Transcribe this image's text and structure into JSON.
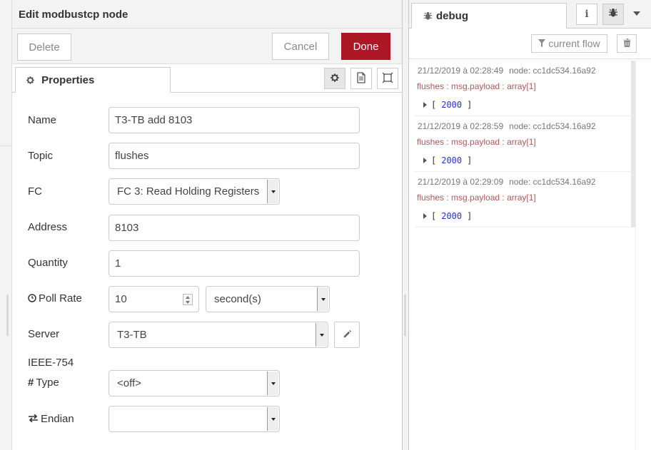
{
  "editor": {
    "title": "Edit modbustcp node",
    "delete_label": "Delete",
    "cancel_label": "Cancel",
    "done_label": "Done",
    "properties_tab": "Properties",
    "fields": {
      "name_label": "Name",
      "name_value": "T3-TB add 8103",
      "topic_label": "Topic",
      "topic_value": "flushes",
      "fc_label": "FC",
      "fc_value": "FC 3: Read Holding Registers",
      "address_label": "Address",
      "address_value": "8103",
      "quantity_label": "Quantity",
      "quantity_value": "1",
      "pollrate_label": "Poll Rate",
      "pollrate_value": "10",
      "pollrate_unit": "second(s)",
      "server_label": "Server",
      "server_value": "T3-TB",
      "ieee_label": "IEEE-754",
      "type_label": "Type",
      "type_value": "<off>",
      "endian_label": "Endian",
      "endian_value": ""
    }
  },
  "sidebar": {
    "tab_label": "debug",
    "info_icon": "i",
    "filter_label": "current flow",
    "messages": [
      {
        "timestamp": "21/12/2019 à 02:28:49",
        "node": "node: cc1dc534.16a92",
        "path": "flushes : msg.payload : array[1]",
        "open": "[",
        "value": "2000",
        "close": "]"
      },
      {
        "timestamp": "21/12/2019 à 02:28:59",
        "node": "node: cc1dc534.16a92",
        "path": "flushes : msg.payload : array[1]",
        "open": "[",
        "value": "2000",
        "close": "]"
      },
      {
        "timestamp": "21/12/2019 à 02:29:09",
        "node": "node: cc1dc534.16a92",
        "path": "flushes : msg.payload : array[1]",
        "open": "[",
        "value": "2000",
        "close": "]"
      }
    ]
  },
  "colors": {
    "done_bg": "#ad1625",
    "msg_path": "#b0575a",
    "payload_num": "#2033d6"
  }
}
